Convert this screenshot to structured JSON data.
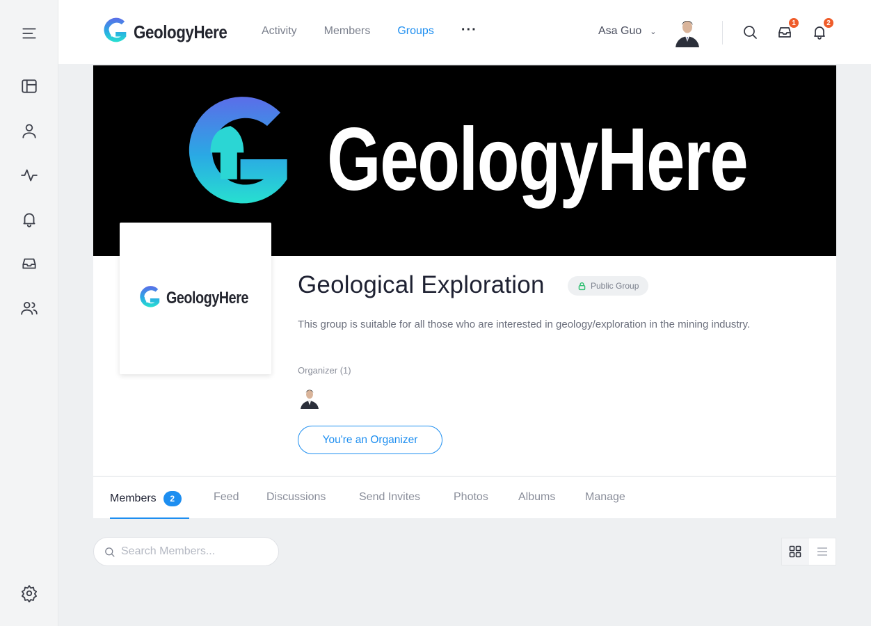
{
  "brand": {
    "name": "GeologyHere"
  },
  "nav": {
    "items": [
      {
        "label": "Activity",
        "active": false
      },
      {
        "label": "Members",
        "active": false
      },
      {
        "label": "Groups",
        "active": true
      }
    ],
    "more_label": "···"
  },
  "user": {
    "name": "Asa Guo"
  },
  "notifications": {
    "messages_count": "1",
    "alerts_count": "2"
  },
  "rail": {
    "icons": [
      "menu-icon",
      "news-feed-icon",
      "profile-icon",
      "activity-icon",
      "notifications-icon",
      "inbox-icon",
      "groups-icon",
      "settings-icon"
    ]
  },
  "cover": {
    "title": "GeologyHere"
  },
  "group": {
    "title": "Geological Exploration",
    "privacy": "Public Group",
    "description": "This group is suitable for all those who are interested in geology/exploration in the mining industry.",
    "organizer_label": "Organizer (1)",
    "organizer_button": "You're an Organizer"
  },
  "tabs": [
    {
      "label": "Members",
      "count": "2",
      "active": true
    },
    {
      "label": "Feed"
    },
    {
      "label": "Discussions"
    },
    {
      "label": "Send Invites"
    },
    {
      "label": "Photos"
    },
    {
      "label": "Albums"
    },
    {
      "label": "Manage"
    }
  ],
  "search": {
    "placeholder": "Search Members..."
  },
  "view": {
    "mode": "grid"
  },
  "colors": {
    "accent": "#1d8ef0",
    "badge": "#ef5c2a",
    "public": "#2fbf71"
  }
}
